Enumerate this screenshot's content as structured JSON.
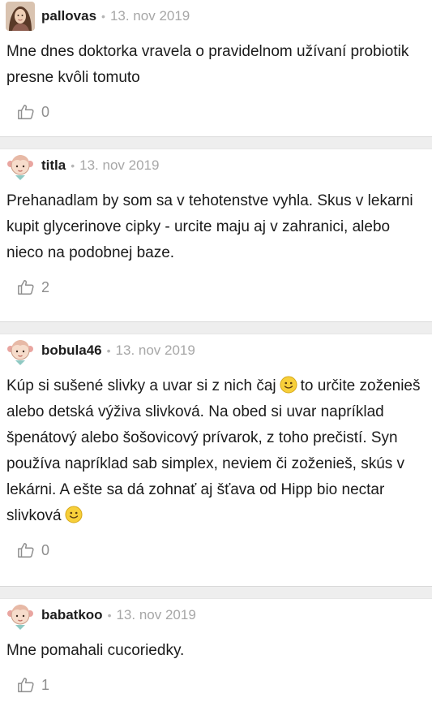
{
  "comments": [
    {
      "username": "pallovas",
      "date": "13. nov 2019",
      "text": "Mne dnes doktorka vravela o pravidelnom užívaní probiotik presne kvôli tomuto",
      "likes": "0",
      "avatar": "photo-avatar"
    },
    {
      "username": "titla",
      "date": "13. nov 2019",
      "text": "Prehanadlam by som sa v tehotenstve vyhla. Skus v lekarni kupit glycerinove cipky - urcite maju aj v zahranici, alebo nieco na podobnej baze.",
      "likes": "2",
      "avatar": "cartoon-girl-avatar"
    },
    {
      "username": "bobula46",
      "date": "13. nov 2019",
      "text_part1": "Kúp si sušené slivky a uvar si z nich čaj",
      "text_part2": "to určite zoženieš alebo detská výživa slivková. Na obed si uvar napríklad špenátový alebo šošovicový prívarok, z toho prečistí. Syn používa napríklad sab simplex, neviem či zoženieš, skús v lekárni. A ešte sa dá zohnať aj šťava od Hipp bio nectar slivková",
      "likes": "0",
      "avatar": "cartoon-girl-avatar"
    },
    {
      "username": "babatkoo",
      "date": "13. nov 2019",
      "text": "Mne pomahali cucoriedky.",
      "likes": "1",
      "avatar": "cartoon-girl-avatar"
    }
  ],
  "separator_dot": "•",
  "icons": {
    "like": "thumbs-up-icon",
    "emoji": "smiley-emoji-icon"
  },
  "colors": {
    "username": "#1d1d1d",
    "date": "#a7a7a7",
    "separator": "#eeeeee",
    "like": "#8e8e8e"
  }
}
